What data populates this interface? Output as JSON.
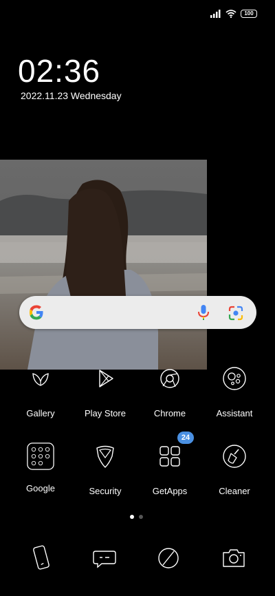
{
  "status": {
    "battery": "100",
    "signal_icon": "signal-icon",
    "wifi_icon": "wifi-icon"
  },
  "clock": {
    "time": "02:36",
    "date": "2022.11.23 Wednesday"
  },
  "search": {
    "logo_icon": "google-g-icon",
    "mic_icon": "mic-icon",
    "lens_icon": "lens-icon"
  },
  "apps": [
    {
      "label": "Gallery"
    },
    {
      "label": "Play Store"
    },
    {
      "label": "Chrome"
    },
    {
      "label": "Assistant"
    },
    {
      "label": "Google"
    },
    {
      "label": "Security"
    },
    {
      "label": "GetApps",
      "badge": "24"
    },
    {
      "label": "Cleaner"
    }
  ],
  "page_indicator": {
    "current": 1,
    "total": 2
  },
  "dock": [
    "phone-icon",
    "messages-icon",
    "browser-icon",
    "camera-icon"
  ],
  "colors": {
    "badge": "#4a90e2",
    "mic_blue": "#4285F4",
    "mic_red": "#EA4335"
  }
}
